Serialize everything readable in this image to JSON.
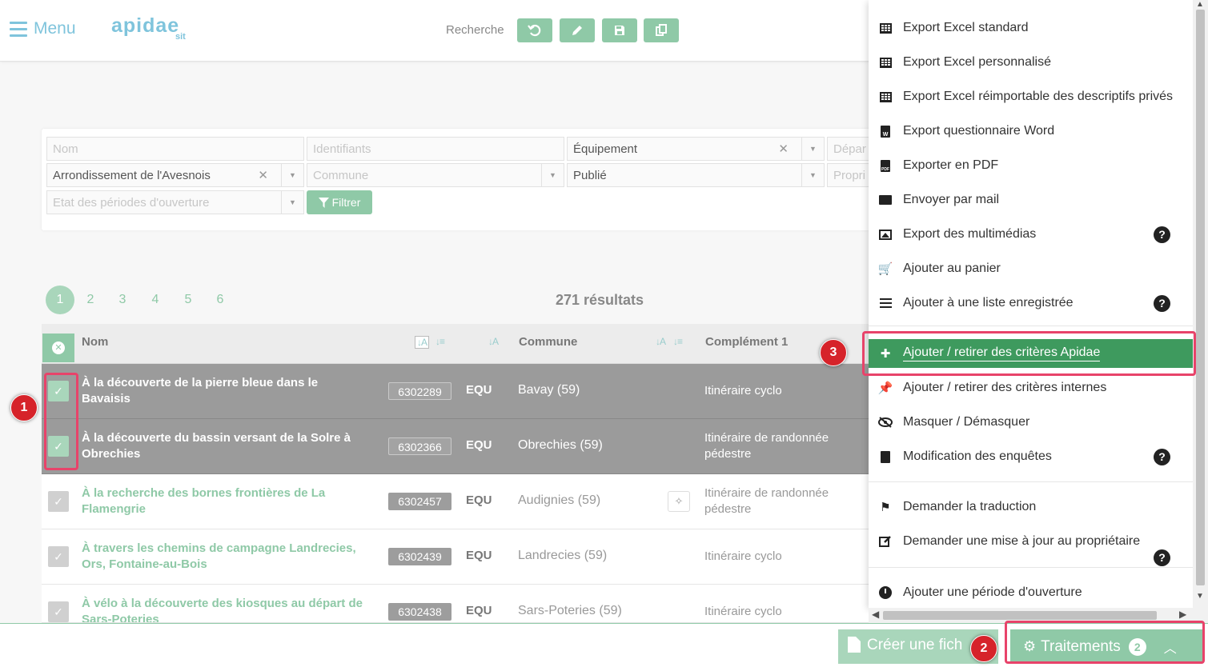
{
  "header": {
    "menu_label": "Menu",
    "logo_text": "apidae",
    "logo_sub": "sit",
    "search_label": "Recherche"
  },
  "filters": {
    "nom_placeholder": "Nom",
    "identifiants_placeholder": "Identifiants",
    "equipement_value": "Équipement",
    "departement_placeholder": "Dépar",
    "arrondissement_value": "Arrondissement de l'Avesnois",
    "commune_placeholder": "Commune",
    "publie_value": "Publié",
    "proprietaire_placeholder": "Propri",
    "periodes_placeholder": "Etat des périodes d'ouverture",
    "filter_button": "Filtrer"
  },
  "pagination": {
    "pages": [
      "1",
      "2",
      "3",
      "4",
      "5",
      "6"
    ],
    "active": "1"
  },
  "results_count": "271 résultats",
  "table": {
    "headers": {
      "nom": "Nom",
      "commune": "Commune",
      "complement": "Complément 1"
    },
    "rows": [
      {
        "name": "À la découverte de la pierre bleue dans le Bavaisis",
        "id": "6302289",
        "type": "EQU",
        "commune": "Bavay (59)",
        "complement": "Itinéraire cyclo",
        "selected": true
      },
      {
        "name": "À la découverte du bassin versant de la Solre à Obrechies",
        "id": "6302366",
        "type": "EQU",
        "commune": "Obrechies (59)",
        "complement": "Itinéraire de randonnée pédestre",
        "selected": true
      },
      {
        "name": "À la recherche des bornes frontières de La Flamengrie",
        "id": "6302457",
        "type": "EQU",
        "commune": "Audignies (59)",
        "complement": "Itinéraire de randonnée pédestre",
        "selected": false
      },
      {
        "name": "À travers les chemins de campagne Landrecies, Ors, Fontaine-au-Bois",
        "id": "6302439",
        "type": "EQU",
        "commune": "Landrecies (59)",
        "complement": "Itinéraire cyclo",
        "selected": false
      },
      {
        "name": "À vélo à la découverte des kiosques au départ de Sars-Poteries",
        "id": "6302438",
        "type": "EQU",
        "commune": "Sars-Poteries (59)",
        "complement": "Itinéraire cyclo",
        "selected": false
      }
    ]
  },
  "footer": {
    "create_label": "Créer une fich",
    "traitements_label": "Traitements",
    "traitements_count": "2"
  },
  "menu": {
    "items": [
      {
        "label": "Export Excel standard",
        "icon": "table-icon"
      },
      {
        "label": "Export Excel personnalisé",
        "icon": "table-icon"
      },
      {
        "label": "Export Excel réimportable des descriptifs privés",
        "icon": "table-icon"
      },
      {
        "label": "Export questionnaire Word",
        "icon": "word-file-icon",
        "glyph": "W"
      },
      {
        "label": "Exporter en PDF",
        "icon": "pdf-file-icon",
        "glyph": "PDF"
      },
      {
        "label": "Envoyer par mail",
        "icon": "envelope-icon"
      },
      {
        "label": "Export des multimédias",
        "icon": "image-icon"
      },
      {
        "label": "Ajouter au panier",
        "icon": "cart-icon"
      },
      {
        "label": "Ajouter à une liste enregistrée",
        "icon": "list-icon"
      },
      {
        "label": "Ajouter / retirer des critères Apidae",
        "icon": "puzzle-icon"
      },
      {
        "label": "Ajouter / retirer des critères internes",
        "icon": "pin-icon"
      },
      {
        "label": "Masquer / Démasquer",
        "icon": "eye-slash-icon"
      },
      {
        "label": "Modification des enquêtes",
        "icon": "document-icon"
      },
      {
        "label": "Demander la traduction",
        "icon": "flag-icon"
      },
      {
        "label": "Demander une mise à jour au propriétaire",
        "icon": "edit-icon"
      },
      {
        "label": "Ajouter une période d'ouverture",
        "icon": "clock-icon"
      }
    ],
    "help_glyph": "?"
  },
  "annotations": [
    "1",
    "2",
    "3"
  ],
  "colors": {
    "accent_green": "#8fc9a7",
    "active_green": "#3e9a5e",
    "highlight_pink": "#e8436a",
    "marker_red": "#d6232a",
    "logo_blue": "#7fc4dc"
  }
}
